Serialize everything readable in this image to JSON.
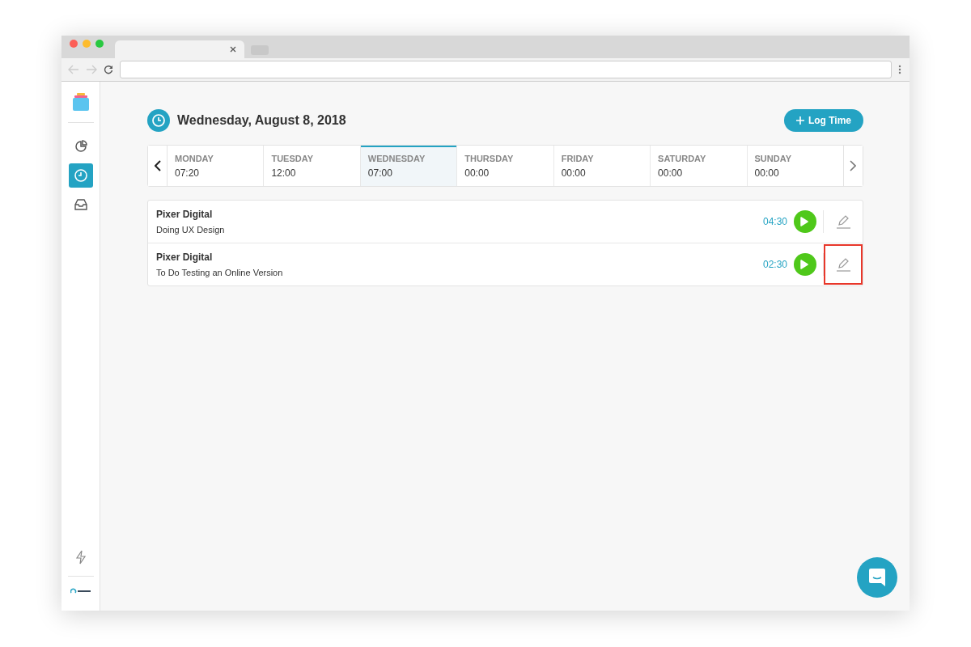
{
  "header": {
    "title": "Wednesday, August 8, 2018",
    "log_button": "Log Time"
  },
  "sidebar": {
    "items": [
      {
        "kind": "reports",
        "selected": false
      },
      {
        "kind": "timesheet",
        "selected": true
      },
      {
        "kind": "inbox",
        "selected": false
      }
    ]
  },
  "days": [
    {
      "name": "MONDAY",
      "time": "07:20",
      "selected": false
    },
    {
      "name": "TUESDAY",
      "time": "12:00",
      "selected": false
    },
    {
      "name": "WEDNESDAY",
      "time": "07:00",
      "selected": true
    },
    {
      "name": "THURSDAY",
      "time": "00:00",
      "selected": false
    },
    {
      "name": "FRIDAY",
      "time": "00:00",
      "selected": false
    },
    {
      "name": "SATURDAY",
      "time": "00:00",
      "selected": false
    },
    {
      "name": "SUNDAY",
      "time": "00:00",
      "selected": false
    }
  ],
  "entries": [
    {
      "client": "Pixer Digital",
      "task": "Doing UX Design",
      "duration": "04:30",
      "highlighted": false
    },
    {
      "client": "Pixer Digital",
      "task": "To Do Testing an Online Version",
      "duration": "02:30",
      "highlighted": true
    }
  ]
}
